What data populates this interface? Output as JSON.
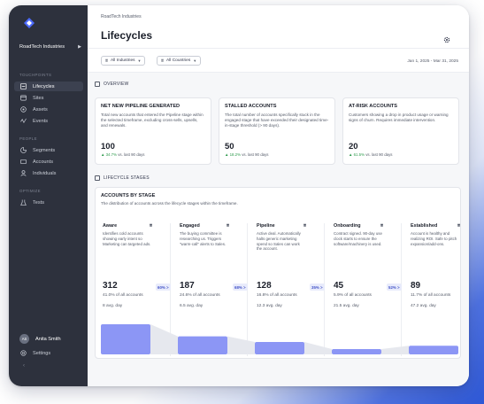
{
  "app": {
    "org_name": "RoadTech Industries"
  },
  "colors": {
    "sidebar_bg": "#2d313d",
    "accent": "#8c96f5",
    "positive": "#2f9b4e"
  },
  "sidebar": {
    "sections": {
      "touchpoints": "TOUCHPOINTS",
      "people": "PEOPLE",
      "optimize": "OPTIMIZE"
    },
    "items": [
      {
        "label": "Lifecycles",
        "icon": "lifecycle-icon",
        "active": true
      },
      {
        "label": "Sites",
        "icon": "sites-icon",
        "active": false
      },
      {
        "label": "Assets",
        "icon": "assets-icon",
        "active": false
      },
      {
        "label": "Events",
        "icon": "events-icon",
        "active": false
      },
      {
        "label": "Segments",
        "icon": "segments-icon",
        "active": false
      },
      {
        "label": "Accounts",
        "icon": "accounts-icon",
        "active": false
      },
      {
        "label": "Individuals",
        "icon": "individuals-icon",
        "active": false
      },
      {
        "label": "Tests",
        "icon": "tests-icon",
        "active": false
      }
    ],
    "user": {
      "initials": "AS",
      "name": "Anita Smith"
    },
    "settings": "Settings",
    "collapse": "‹"
  },
  "header": {
    "breadcrumb": "RoadTech Industries",
    "title": "Lifecycles"
  },
  "filters": {
    "industries": "All Industries",
    "countries": "All Countries",
    "date_range": "Jan 1, 2025 - Mar 31, 2025"
  },
  "overview": {
    "heading": "OVERVIEW",
    "cards": [
      {
        "title": "NET NEW PIPELINE GENERATED",
        "desc": "Total new accounts that entered the Pipeline stage within the selected timeframe, excluding cross-sells, upsells, and renewals.",
        "value": "100",
        "change": "▲ 34.7%",
        "compare": " vs. last 90 days"
      },
      {
        "title": "STALLED ACCOUNTS",
        "desc": "The total number of accounts specifically stuck in the engaged stage that have exceeded their designated time-in-stage threshold (> 90 days).",
        "value": "50",
        "change": "▲ 18.2%",
        "compare": " vs. last 90 days"
      },
      {
        "title": "AT-RISK ACCOUNTS",
        "desc": "Customers showing a drop in product usage or warning signs of churn. Requires immediate intervention.",
        "value": "20",
        "change": "▲ 61.5%",
        "compare": " vs. last 90 days"
      }
    ]
  },
  "lifecycle": {
    "heading": "LIFECYCLE STAGES",
    "title": "ACCOUNTS BY STAGE",
    "desc": "The distribution of accounts across the lifecycle stages within the timeframe.",
    "stages": [
      {
        "name": "Aware",
        "desc": "Identifies cold accounts showing early intent so Marketing can targeted ads.",
        "value": "312",
        "pct": "41.0% of all accounts",
        "avg": "8  avg. day",
        "count": 312
      },
      {
        "name": "Engaged",
        "desc": "The buying committee is researching us. Triggers \"warm-call\" alerts to Sales.",
        "value": "187",
        "pct": "24.6% of all accounts",
        "avg": "6.5  avg. day",
        "count": 187
      },
      {
        "name": "Pipeline",
        "desc": "Active deal. Automatically halts generic marketing spend so Sales can work the account.",
        "value": "128",
        "pct": "16.8% of all accounts",
        "avg": "12.3  avg. day",
        "count": 128
      },
      {
        "name": "Onboarding",
        "desc": "Contract signed. 90-day use clock starts to ensure the software/machinery is used.",
        "value": "45",
        "pct": "5.9% of all accounts",
        "avg": "21.5  avg. day",
        "count": 45
      },
      {
        "name": "Established",
        "desc": "Account is healthy and realizing ROI. Safe to pitch expansion/add-ons.",
        "value": "89",
        "pct": "11.7% of all accounts",
        "avg": "47.2  avg. day",
        "count": 89
      }
    ],
    "conversions": [
      "60% >",
      "68% >",
      "35% >",
      "52% >"
    ]
  }
}
